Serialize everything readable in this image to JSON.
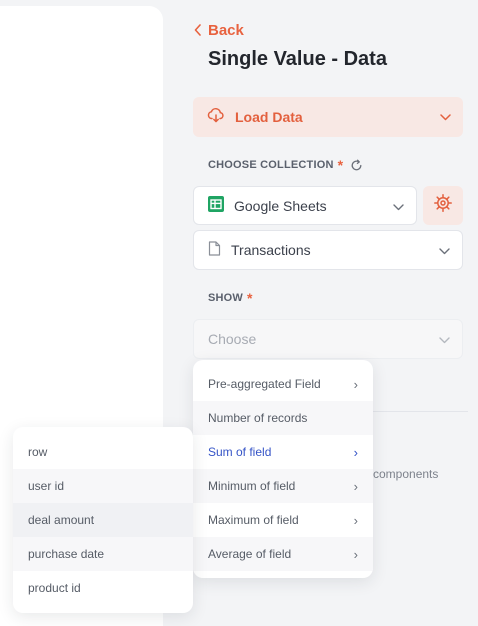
{
  "panel": {
    "back_label": "Back",
    "title": "Single Value - Data",
    "load_data_label": "Load Data",
    "choose_collection_label": "CHOOSE COLLECTION",
    "required_mark": "*",
    "source_select_value": "Google Sheets",
    "collection_select_value": "Transactions",
    "show_label": "SHOW",
    "show_placeholder": "Choose",
    "components_text": "components"
  },
  "aggregation_menu": {
    "items": [
      {
        "label": "Pre-aggregated Field",
        "has_submenu": true
      },
      {
        "label": "Number of records",
        "has_submenu": false
      },
      {
        "label": "Sum of field",
        "has_submenu": true,
        "active": true
      },
      {
        "label": "Minimum of field",
        "has_submenu": true
      },
      {
        "label": "Maximum of field",
        "has_submenu": true
      },
      {
        "label": "Average of field",
        "has_submenu": true
      }
    ],
    "arrow_glyph": "›"
  },
  "field_submenu": {
    "items": [
      "row",
      "user id",
      "deal amount",
      "purchase date",
      "product id"
    ],
    "highlighted": "deal amount"
  },
  "colors": {
    "accent": "#e8623f",
    "accent_bg": "#f8e8e4",
    "link_active": "#3554c7",
    "sheets_green": "#1fa463"
  },
  "icons": {
    "back": "chevron-left-icon",
    "load": "cloud-download-icon",
    "refresh": "refresh-icon",
    "sheets": "google-sheets-icon",
    "file": "file-icon",
    "gear": "gear-icon",
    "dropdown": "chevron-down-icon",
    "submenu": "chevron-right-icon"
  }
}
